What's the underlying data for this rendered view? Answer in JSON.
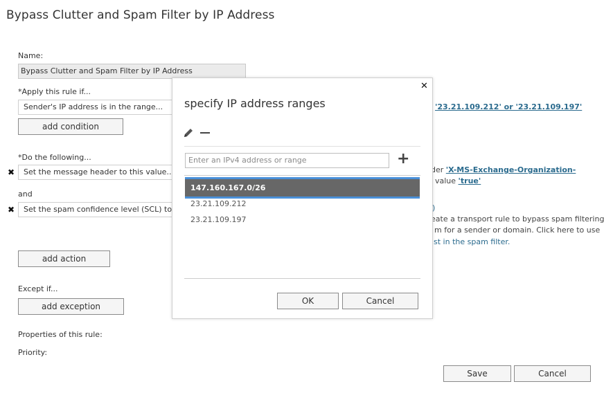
{
  "page": {
    "title": "Bypass Clutter and Spam Filter by IP Address"
  },
  "name": {
    "label": "Name:",
    "value": "Bypass Clutter and Spam Filter by IP Address"
  },
  "apply": {
    "label": "*Apply this rule if...",
    "condition": "Sender's IP address is in the range...",
    "add_condition": "add condition",
    "link_text": "'23.21.109.212' or '23.21.109.197'"
  },
  "do": {
    "label": "*Do the following...",
    "action1": "Set the message header to this value...",
    "and_label": "and",
    "action2": "Set the spam confidence level (SCL) to...",
    "add_action": "add action",
    "header_prefix": "der ",
    "header_link": "'X-MS-Exchange-Organization-",
    "value_prefix": "value ",
    "value_link": "'true'",
    "scl_fragment": ")",
    "desc_line1": "eate a transport rule to bypass spam filtering",
    "desc_line2": "m for a sender or domain. Click here to use",
    "desc_line3": "st in the spam filter."
  },
  "except": {
    "label": "Except if...",
    "add_exception": "add exception"
  },
  "properties": {
    "label": "Properties of this rule:",
    "priority": "Priority:"
  },
  "footer": {
    "save": "Save",
    "cancel": "Cancel"
  },
  "dialog": {
    "title": "specify IP address ranges",
    "input_placeholder": "Enter an IPv4 address or range",
    "items": [
      "147.160.167.0/26",
      "23.21.109.212",
      "23.21.109.197"
    ],
    "ok": "OK",
    "cancel": "Cancel"
  },
  "colors": {
    "selection": "#676767",
    "selection_border": "#4a90d9",
    "link": "#2b6b8e"
  }
}
